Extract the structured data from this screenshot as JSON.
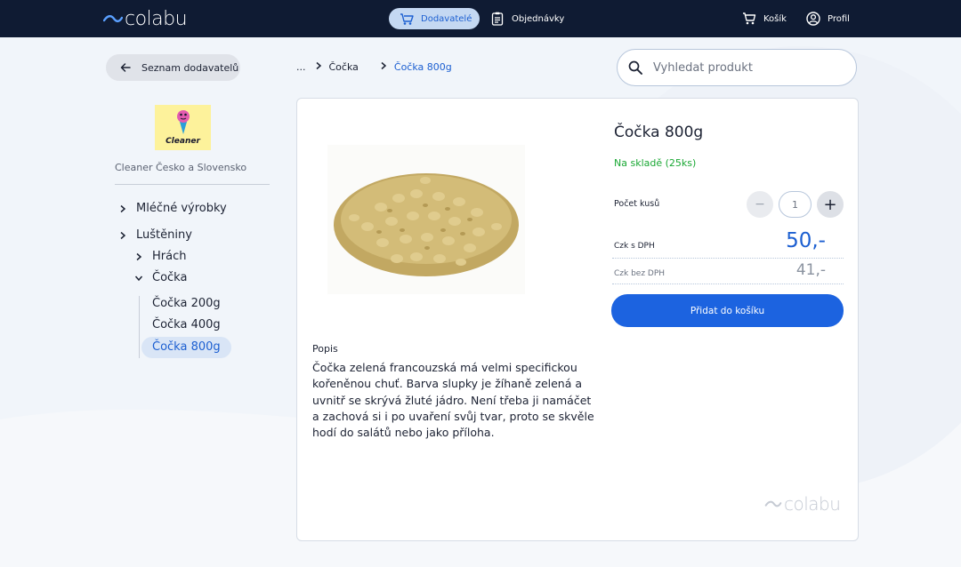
{
  "brand": {
    "name": "colabu"
  },
  "topnav": {
    "suppliers": "Dodavatelé",
    "orders": "Objednávky",
    "cart": "Košík",
    "profile": "Profil"
  },
  "back_button": "Seznam dodavatelů",
  "supplier": {
    "logo_text": "Cleaner",
    "name": "Cleaner Česko a Slovensko"
  },
  "categories": {
    "dairy": "Mléčné výrobky",
    "legumes": "Luštěniny",
    "peas": "Hrách",
    "lentils": "Čočka",
    "leaves": [
      "Čočka 200g",
      "Čočka 400g",
      "Čočka 800g"
    ]
  },
  "breadcrumb": {
    "ellipsis": "...",
    "parent": "Čočka",
    "current": "Čočka 800g"
  },
  "search": {
    "placeholder": "Vyhledat produkt"
  },
  "product": {
    "title": "Čočka 800g",
    "stock": "Na skladě (25ks)",
    "qty_label": "Počet kusů",
    "qty_value": "1",
    "qty_minus": "−",
    "qty_plus": "+",
    "price_vat_label": "Czk s DPH",
    "price_vat": "50,-",
    "price_novat_label": "Czk bez DPH",
    "price_novat": "41,-",
    "add_button": "Přidat do košíku",
    "desc_heading": "Popis",
    "description": "Čočka zelená francouzská má velmi specifickou kořeněnou chuť. Barva slupky je žíhaně zelená a uvnitř se skrývá žluté jádro. Není třeba ji namáčet a zachová si i po uvaření svůj tvar, proto se skvěle hodí do salátů nebo jako příloha."
  },
  "colors": {
    "topbar": "#0f1b33",
    "accent": "#1c63e0",
    "stock": "#1aa834"
  },
  "icons": [
    "cart-truck-icon",
    "orders-icon",
    "cart-icon",
    "profile-icon",
    "arrow-left-icon",
    "search-icon",
    "chevron-right-icon",
    "chevron-down-icon",
    "minus-icon",
    "plus-icon"
  ]
}
